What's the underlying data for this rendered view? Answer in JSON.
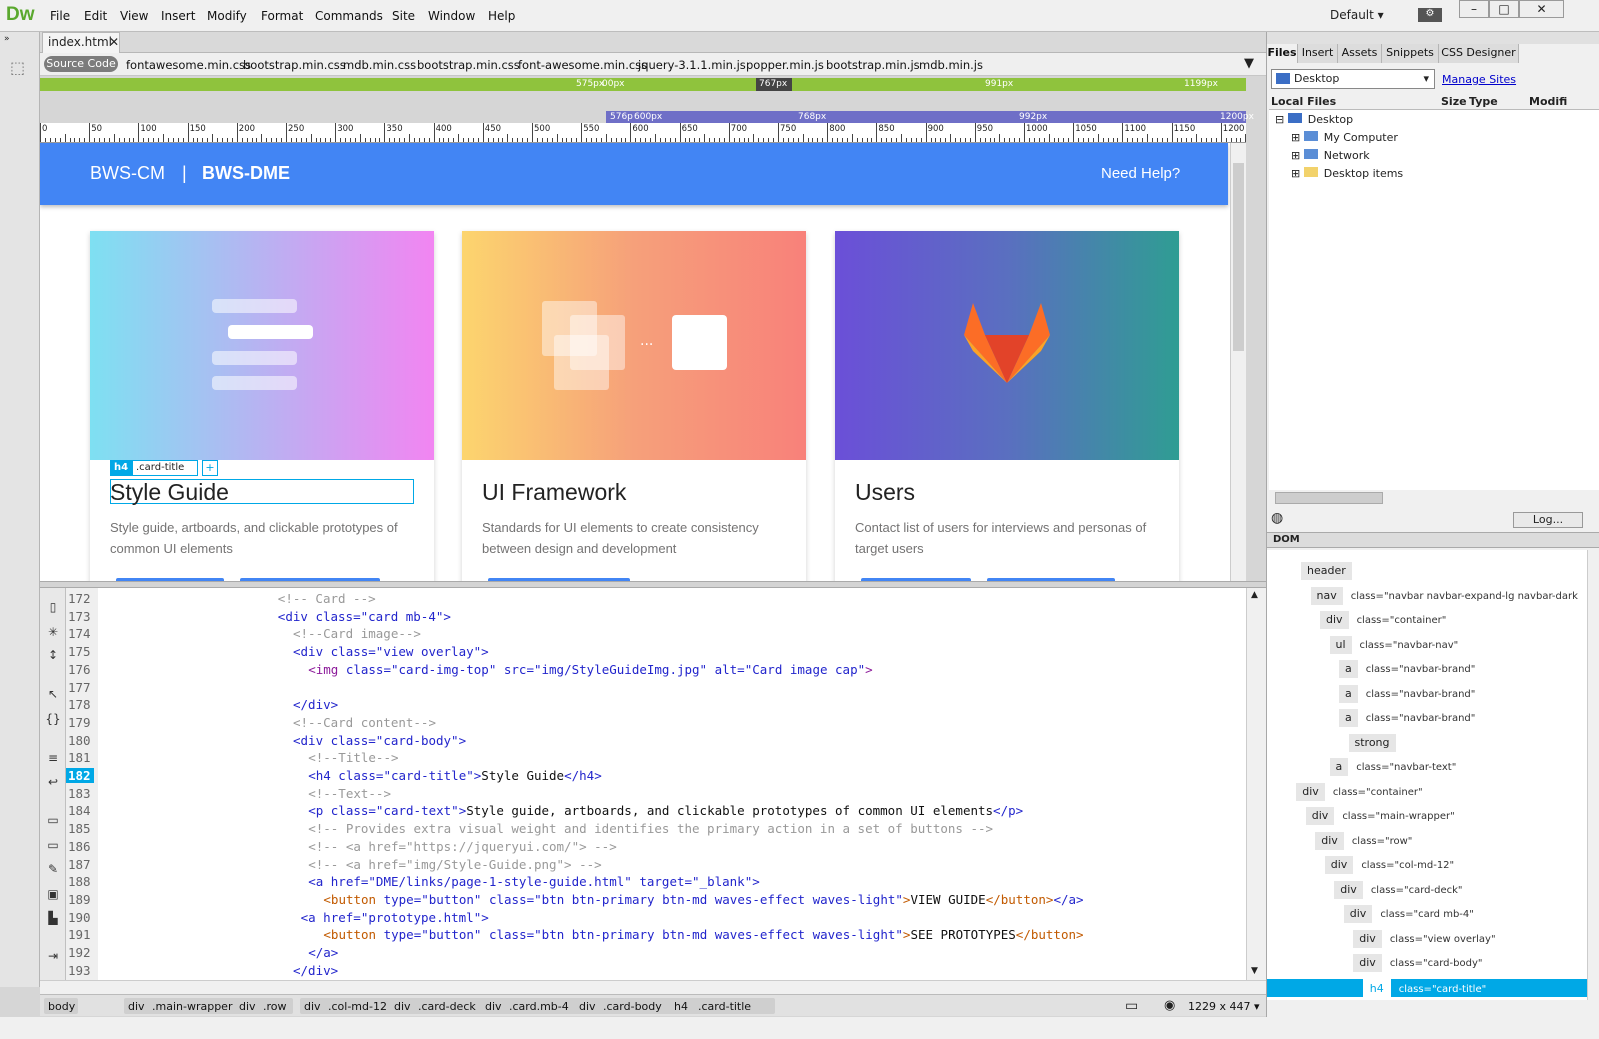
{
  "app": {
    "logo": "Dw",
    "workspace": "Default"
  },
  "menu": [
    "File",
    "Edit",
    "View",
    "Insert",
    "Modify",
    "Format",
    "Commands",
    "Site",
    "Window",
    "Help"
  ],
  "document": {
    "tab": "index.html",
    "source_label": "Source Code",
    "related_files": [
      "fontawesome.min.css",
      "bootstrap.min.css",
      "mdb.min.css",
      "bootstrap.min.css",
      "font-awesome.min.css",
      "jquery-3.1.1.min.js",
      "popper.min.js",
      "bootstrap.min.js",
      "mdb.min.js"
    ]
  },
  "media_queries": {
    "top": [
      "575px",
      "00px",
      "767px",
      "991px",
      "1199px"
    ],
    "bottom": [
      "576p",
      "600px",
      "768px",
      "992px",
      "1200px"
    ]
  },
  "ruler": [
    "0",
    "50",
    "100",
    "150",
    "200",
    "250",
    "300",
    "350",
    "400",
    "450",
    "500",
    "550",
    "600",
    "650",
    "700",
    "750",
    "800",
    "850",
    "900",
    "950",
    "1000",
    "1050",
    "1100",
    "1150",
    "1200"
  ],
  "page": {
    "brand1": "BWS-CM",
    "separator": "|",
    "brand2": "BWS-DME",
    "help": "Need Help?",
    "cards": [
      {
        "title": "Style Guide",
        "text": "Style guide, artboards, and clickable prototypes of common UI elements"
      },
      {
        "title": "UI Framework",
        "text": "Standards for UI elements to create consistency between design and development"
      },
      {
        "title": "Users",
        "text": "Contact list of users for interviews and personas of target users"
      }
    ],
    "selection": {
      "tag": "h4",
      "class": ".card-title",
      "add": "+"
    }
  },
  "code": {
    "lines": [
      {
        "n": "172",
        "indent": 23,
        "parts": [
          [
            "cm",
            "<!-- Card -->"
          ]
        ]
      },
      {
        "n": "173",
        "indent": 23,
        "parts": [
          [
            "tg",
            "<div "
          ],
          [
            "at",
            "class="
          ],
          [
            "vl",
            "\"card mb-4\""
          ],
          [
            "tg",
            ">"
          ]
        ]
      },
      {
        "n": "174",
        "indent": 25,
        "parts": [
          [
            "cm",
            "<!--Card image-->"
          ]
        ]
      },
      {
        "n": "175",
        "indent": 25,
        "parts": [
          [
            "tg",
            "<div "
          ],
          [
            "at",
            "class="
          ],
          [
            "vl",
            "\"view overlay\""
          ],
          [
            "tg",
            ">"
          ]
        ]
      },
      {
        "n": "176",
        "indent": 27,
        "parts": [
          [
            "im",
            "<img "
          ],
          [
            "at",
            "class="
          ],
          [
            "vl",
            "\"card-img-top\" "
          ],
          [
            "at",
            "src="
          ],
          [
            "vl",
            "\"img/StyleGuideImg.jpg\" "
          ],
          [
            "at",
            "alt="
          ],
          [
            "vl",
            "\"Card image cap\""
          ],
          [
            "im",
            ">"
          ]
        ]
      },
      {
        "n": "177",
        "indent": 0,
        "parts": []
      },
      {
        "n": "178",
        "indent": 25,
        "parts": [
          [
            "tg",
            "</div>"
          ]
        ]
      },
      {
        "n": "179",
        "indent": 25,
        "parts": [
          [
            "cm",
            "<!--Card content-->"
          ]
        ]
      },
      {
        "n": "180",
        "indent": 25,
        "parts": [
          [
            "tg",
            "<div "
          ],
          [
            "at",
            "class="
          ],
          [
            "vl",
            "\"card-body\""
          ],
          [
            "tg",
            ">"
          ]
        ]
      },
      {
        "n": "181",
        "indent": 27,
        "parts": [
          [
            "cm",
            "<!--Title-->"
          ]
        ]
      },
      {
        "n": "182",
        "indent": 27,
        "parts": [
          [
            "tg",
            "<h4 "
          ],
          [
            "at",
            "class="
          ],
          [
            "vl",
            "\"card-title\""
          ],
          [
            "tg",
            ">"
          ],
          [
            "tx",
            "Style Guide"
          ],
          [
            "tg",
            "</h4>"
          ]
        ]
      },
      {
        "n": "183",
        "indent": 27,
        "parts": [
          [
            "cm",
            "<!--Text-->"
          ]
        ]
      },
      {
        "n": "184",
        "indent": 27,
        "parts": [
          [
            "tg",
            "<p "
          ],
          [
            "at",
            "class="
          ],
          [
            "vl",
            "\"card-text\""
          ],
          [
            "tg",
            ">"
          ],
          [
            "tx",
            "Style guide, artboards, and clickable prototypes of common UI elements"
          ],
          [
            "tg",
            "</p>"
          ]
        ]
      },
      {
        "n": "185",
        "indent": 27,
        "parts": [
          [
            "cm",
            "<!-- Provides extra visual weight and identifies the primary action in a set of buttons -->"
          ]
        ]
      },
      {
        "n": "186",
        "indent": 27,
        "parts": [
          [
            "cm",
            "<!-- <a href=\"https://jqueryui.com/\"> -->"
          ]
        ]
      },
      {
        "n": "187",
        "indent": 27,
        "parts": [
          [
            "cm",
            "<!-- <a href=\"img/Style-Guide.png\"> -->"
          ]
        ]
      },
      {
        "n": "188",
        "indent": 27,
        "parts": [
          [
            "tg",
            "<a "
          ],
          [
            "at",
            "href="
          ],
          [
            "vl",
            "\"DME/links/page-1-style-guide.html\" "
          ],
          [
            "at",
            "target="
          ],
          [
            "vl",
            "\"_blank\""
          ],
          [
            "tg",
            ">"
          ]
        ]
      },
      {
        "n": "189",
        "indent": 29,
        "parts": [
          [
            "bt",
            "<button "
          ],
          [
            "at",
            "type="
          ],
          [
            "vl",
            "\"button\" "
          ],
          [
            "at",
            "class="
          ],
          [
            "vl",
            "\"btn btn-primary btn-md waves-effect waves-light\""
          ],
          [
            "bt",
            ">"
          ],
          [
            "tx",
            "VIEW GUIDE"
          ],
          [
            "bt",
            "</button>"
          ],
          [
            "tg",
            "</a>"
          ]
        ]
      },
      {
        "n": "190",
        "indent": 26,
        "parts": [
          [
            "tg",
            "<a "
          ],
          [
            "at",
            "href="
          ],
          [
            "vl",
            "\"prototype.html\""
          ],
          [
            "tg",
            ">"
          ]
        ]
      },
      {
        "n": "191",
        "indent": 29,
        "parts": [
          [
            "bt",
            "<button "
          ],
          [
            "at",
            "type="
          ],
          [
            "vl",
            "\"button\" "
          ],
          [
            "at",
            "class="
          ],
          [
            "vl",
            "\"btn btn-primary btn-md waves-effect waves-light\""
          ],
          [
            "bt",
            ">"
          ],
          [
            "tx",
            "SEE PROTOTYPES"
          ],
          [
            "bt",
            "</button>"
          ]
        ]
      },
      {
        "n": "192",
        "indent": 27,
        "parts": [
          [
            "tg",
            "</a>"
          ]
        ]
      },
      {
        "n": "193",
        "indent": 25,
        "parts": [
          [
            "tg",
            "</div>"
          ]
        ]
      }
    ],
    "current": "182"
  },
  "tag_selector": [
    [
      "body",
      ""
    ],
    [
      "div",
      ".main-wrapper"
    ],
    [
      "div",
      ".row"
    ],
    [
      "div",
      ".col-md-12"
    ],
    [
      "div",
      ".card-deck"
    ],
    [
      "div",
      ".card.mb-4"
    ],
    [
      "div",
      ".card-body"
    ],
    [
      "h4",
      ".card-title"
    ]
  ],
  "viewport": "1229 x 447",
  "panels": {
    "tabs": [
      "Files",
      "Insert",
      "Assets",
      "Snippets",
      "CSS Designer"
    ],
    "site": "Desktop",
    "manage": "Manage Sites",
    "columns": [
      "Local Files",
      "Size",
      "Type",
      "Modifi"
    ],
    "tree": [
      {
        "label": "Desktop",
        "depth": 0
      },
      {
        "label": "My Computer",
        "depth": 1
      },
      {
        "label": "Network",
        "depth": 1
      },
      {
        "label": "Desktop items",
        "depth": 1
      }
    ],
    "log": "Log...",
    "dom_label": "DOM",
    "dom": [
      {
        "tag": "header",
        "cls": "",
        "d": 0
      },
      {
        "tag": "nav",
        "cls": "class=\"navbar navbar-expand-lg navbar-dark",
        "d": 1
      },
      {
        "tag": "div",
        "cls": "class=\"container\"",
        "d": 2
      },
      {
        "tag": "ul",
        "cls": "class=\"navbar-nav\"",
        "d": 3
      },
      {
        "tag": "a",
        "cls": "class=\"navbar-brand\"",
        "d": 4
      },
      {
        "tag": "a",
        "cls": "class=\"navbar-brand\"",
        "d": 4
      },
      {
        "tag": "a",
        "cls": "class=\"navbar-brand\"",
        "d": 4
      },
      {
        "tag": "strong",
        "cls": "",
        "d": 5
      },
      {
        "tag": "a",
        "cls": "class=\"navbar-text\"",
        "d": 3
      },
      {
        "tag": "div",
        "cls": "class=\"container\"",
        "d": -0.5
      },
      {
        "tag": "div",
        "cls": "class=\"main-wrapper\"",
        "d": 0.5
      },
      {
        "tag": "div",
        "cls": "class=\"row\"",
        "d": 1.5
      },
      {
        "tag": "div",
        "cls": "class=\"col-md-12\"",
        "d": 2.5
      },
      {
        "tag": "div",
        "cls": "class=\"card-deck\"",
        "d": 3.5
      },
      {
        "tag": "div",
        "cls": "class=\"card mb-4\"",
        "d": 4.5
      },
      {
        "tag": "div",
        "cls": "class=\"view overlay\"",
        "d": 5.5
      },
      {
        "tag": "div",
        "cls": "class=\"card-body\"",
        "d": 5.5
      },
      {
        "tag": "h4",
        "cls": "class=\"card-title\"",
        "d": 6.5
      }
    ]
  },
  "colors": {
    "accent": "#4285f4",
    "selection": "#00a8e6",
    "mq_green": "#8fc33d",
    "mq_blue": "#6f6fc7"
  }
}
